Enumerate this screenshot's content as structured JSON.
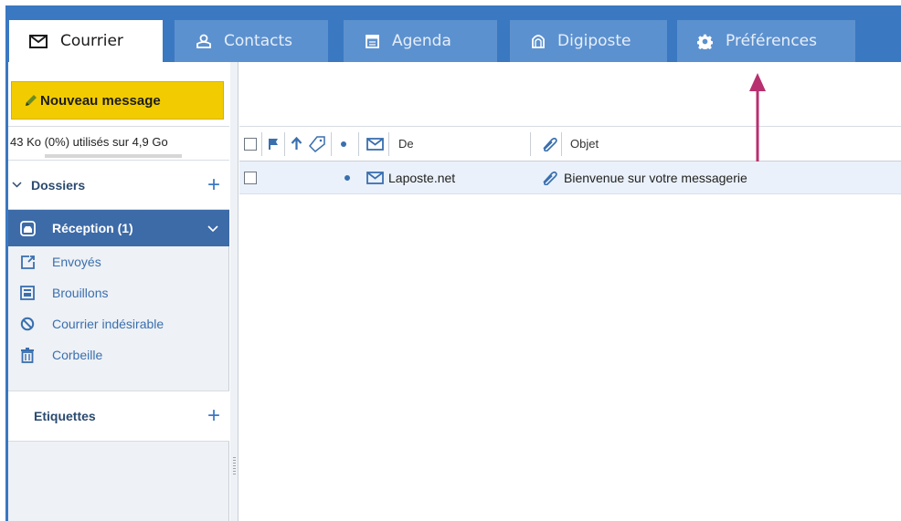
{
  "tabs": [
    {
      "label": "Courrier",
      "icon": "envelope-icon",
      "active": true
    },
    {
      "label": "Contacts",
      "icon": "contacts-icon",
      "active": false
    },
    {
      "label": "Agenda",
      "icon": "calendar-icon",
      "active": false
    },
    {
      "label": "Digiposte",
      "icon": "digiposte-icon",
      "active": false
    },
    {
      "label": "Préférences",
      "icon": "gear-icon",
      "active": false
    }
  ],
  "sidebar": {
    "new_message_label": "Nouveau message",
    "quota_text": "43 Ko (0%) utilisés sur 4,9 Go",
    "quota_fraction": 0.0,
    "folders_title": "Dossiers",
    "folders": [
      {
        "label": "Réception (1)",
        "icon": "inbox-icon",
        "selected": true
      },
      {
        "label": "Envoyés",
        "icon": "sent-icon",
        "selected": false
      },
      {
        "label": "Brouillons",
        "icon": "drafts-icon",
        "selected": false
      },
      {
        "label": "Courrier indésirable",
        "icon": "spam-icon",
        "selected": false
      },
      {
        "label": "Corbeille",
        "icon": "trash-icon",
        "selected": false
      }
    ],
    "labels_title": "Etiquettes"
  },
  "message_list": {
    "columns": {
      "from": "De",
      "subject": "Objet"
    },
    "rows": [
      {
        "from": "Laposte.net",
        "subject": "Bienvenue sur votre messagerie",
        "unread": true,
        "has_attachment": true
      }
    ]
  },
  "colors": {
    "brand_blue": "#3a78c2",
    "tab_inactive": "#5c91cf",
    "selected_folder": "#3d6ba8",
    "new_message_button": "#f2cc00",
    "annotation_arrow": "#b8306f"
  }
}
